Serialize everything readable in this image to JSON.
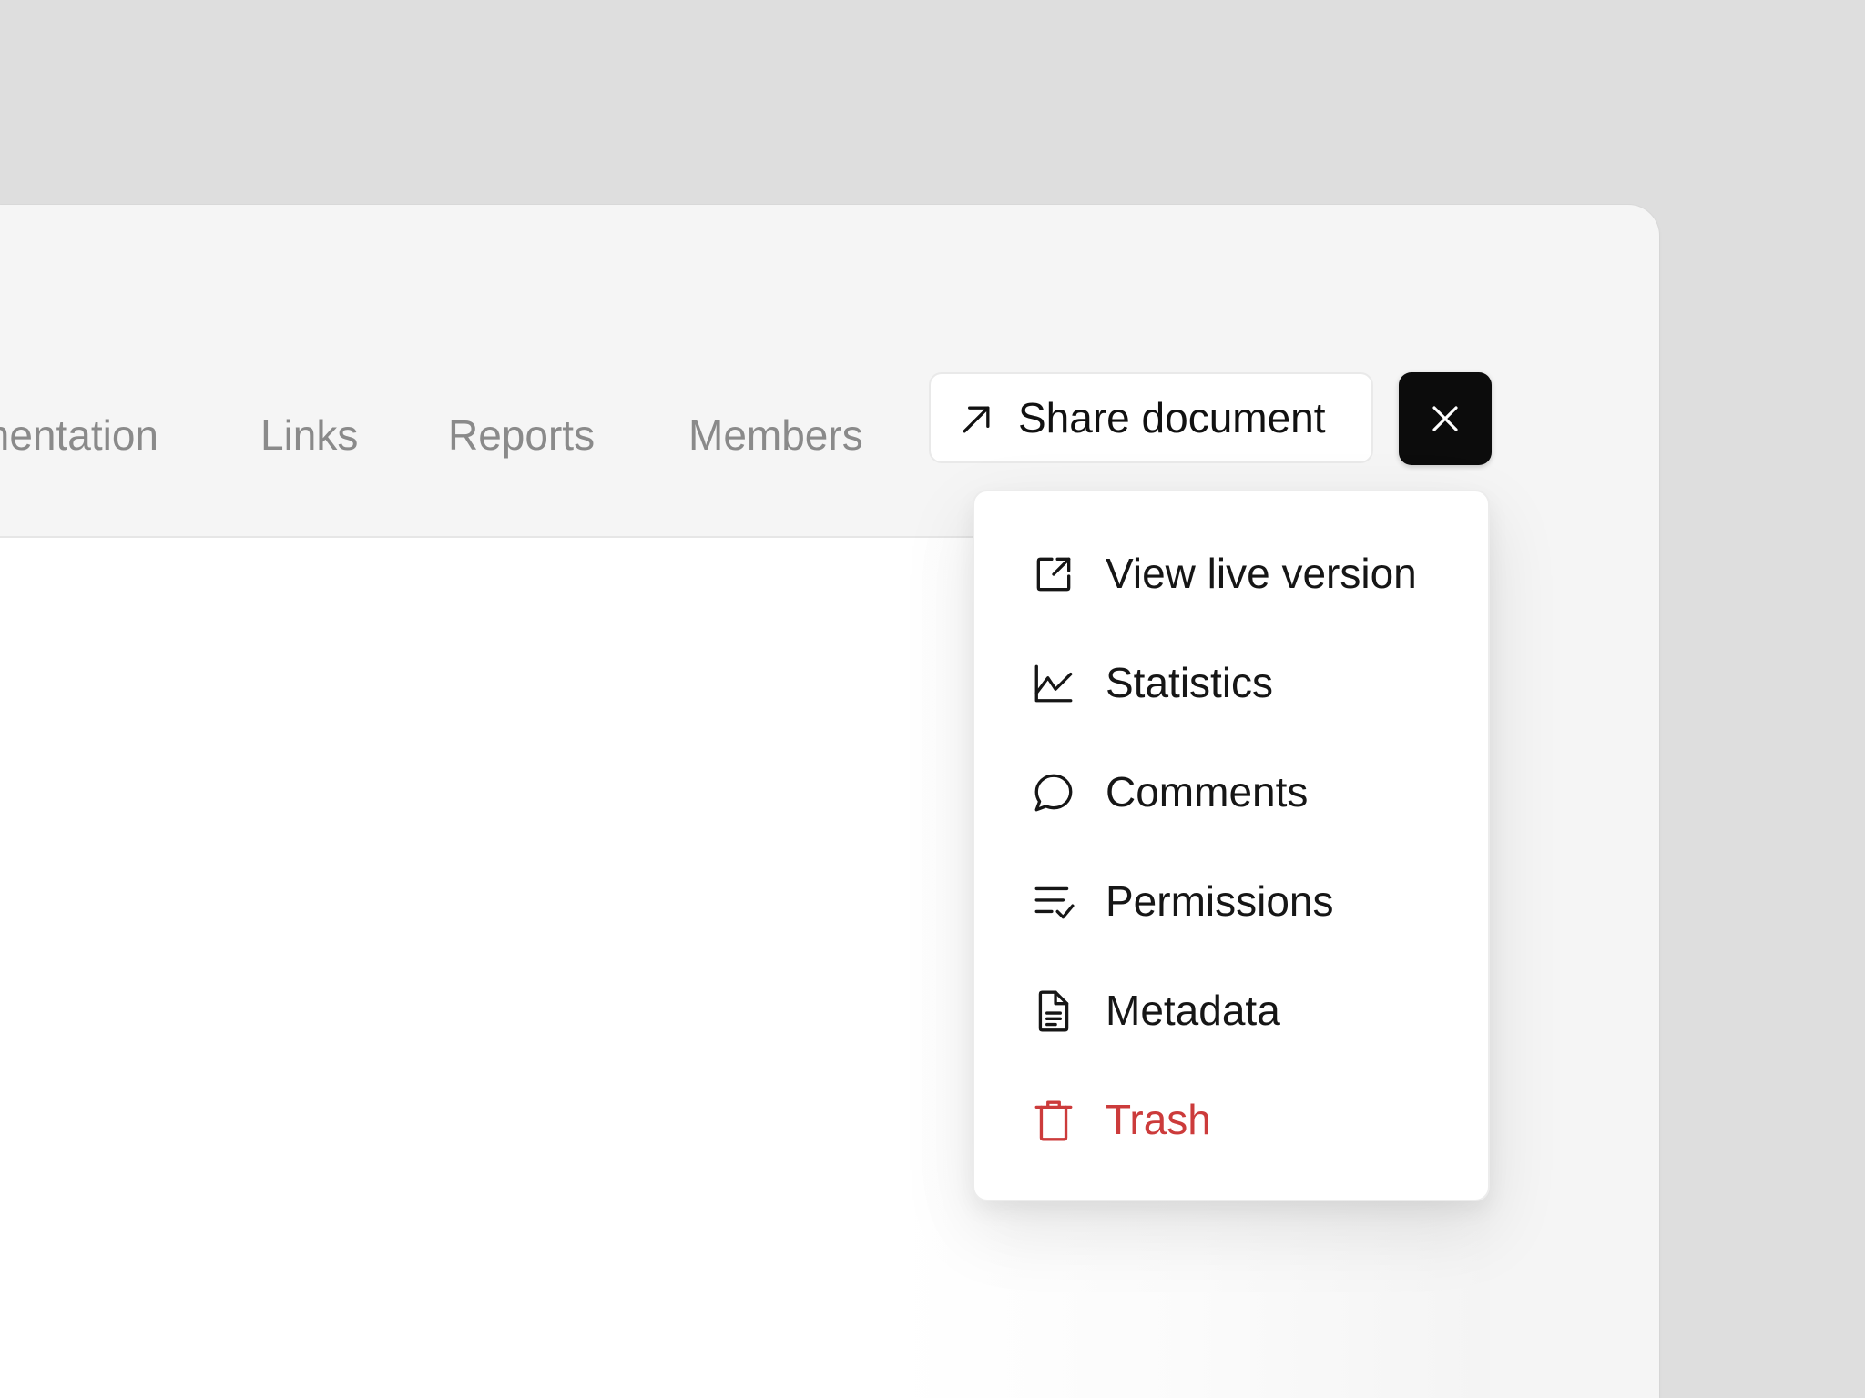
{
  "nav": {
    "tabs": [
      {
        "label": "mentation"
      },
      {
        "label": "Links"
      },
      {
        "label": "Reports"
      },
      {
        "label": "Members"
      }
    ]
  },
  "toolbar": {
    "share_label": "Share document",
    "share_icon": "arrow-up-right-icon",
    "close_icon": "close-icon"
  },
  "menu": {
    "items": [
      {
        "label": "View live version",
        "icon": "external-link-icon"
      },
      {
        "label": "Statistics",
        "icon": "line-chart-icon"
      },
      {
        "label": "Comments",
        "icon": "speech-bubble-icon"
      },
      {
        "label": "Permissions",
        "icon": "list-check-icon"
      },
      {
        "label": "Metadata",
        "icon": "document-icon"
      },
      {
        "label": "Trash",
        "icon": "trash-icon"
      }
    ]
  },
  "colors": {
    "background": "#dedede",
    "window": "#f5f5f5",
    "tab_text": "#8a8a8a",
    "danger": "#cc3b3b",
    "close_button": "#0c0c0c"
  }
}
